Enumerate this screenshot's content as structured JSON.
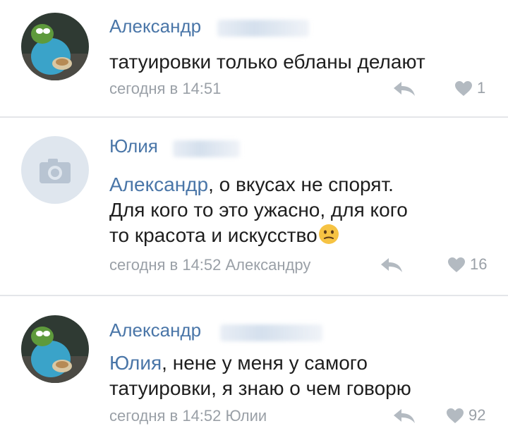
{
  "comments": [
    {
      "author": "Александр",
      "text": "татуировки только ебланы делают",
      "time": "сегодня в 14:51",
      "likes": "1",
      "avatar": "pepe-frog-avatar"
    },
    {
      "author": "Юлия",
      "mention": "Александр",
      "text_after_mention": ", о вкусах не спорят.",
      "line2": "Для кого то это ужасно,  для кого",
      "line3": "то красота и искусство",
      "emoji": "confused-face-emoji",
      "time": "сегодня в 14:52 Александру",
      "likes": "16",
      "avatar": "camera-placeholder-avatar"
    },
    {
      "author": "Александр",
      "mention": "Юлия",
      "text_after_mention": ", нене у меня у самого",
      "line2": "татуировки, я знаю о чем говорю",
      "time": "сегодня в 14:52 Юлии",
      "likes": "92",
      "avatar": "pepe-frog-avatar"
    }
  ],
  "colors": {
    "link": "#4a76a8",
    "meta": "#9aa0a7",
    "divider": "#e4e6e9",
    "avatar_placeholder": "#dfe6ee"
  }
}
